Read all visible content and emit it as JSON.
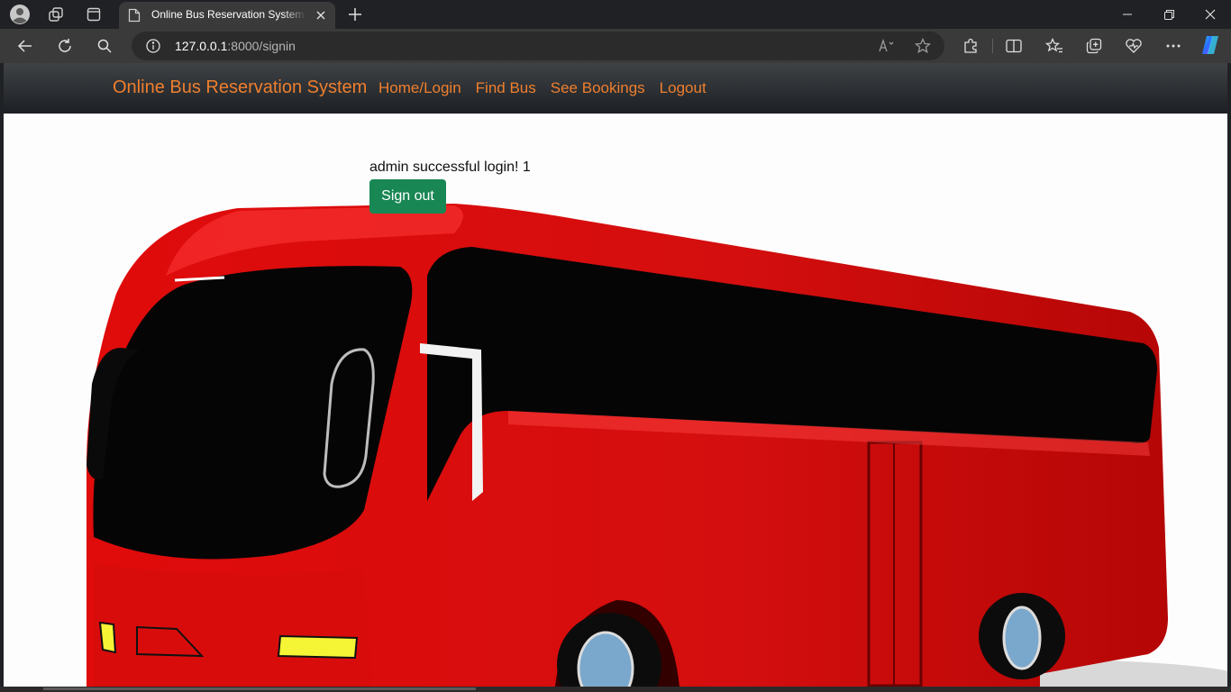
{
  "browser": {
    "tab_title": "Online Bus Reservation System in Django",
    "url_host": "127.0.0.1",
    "url_path": ":8000/signin",
    "icons": [
      "profile-icon",
      "workspaces-icon",
      "tab-actions-icon",
      "page-icon",
      "close-icon",
      "new-tab-icon",
      "back-icon",
      "refresh-icon",
      "search-icon",
      "site-info-icon",
      "read-aloud-icon",
      "favorite-icon",
      "extensions-icon",
      "split-screen-icon",
      "favorites-icon",
      "collections-icon",
      "browser-essentials-icon",
      "more-icon",
      "copilot-icon",
      "minimize-icon",
      "restore-icon",
      "window-close-icon"
    ]
  },
  "navbar": {
    "brand": "Online Bus Reservation System",
    "links": [
      "Home/Login",
      "Find Bus",
      "See Bookings",
      "Logout"
    ]
  },
  "main": {
    "message": "admin successful login! 1",
    "signout_label": "Sign out"
  },
  "colors": {
    "navbar": "#212529",
    "nav_link": "#ef7e2e",
    "button": "#198754",
    "bus_red": "#e01010"
  }
}
